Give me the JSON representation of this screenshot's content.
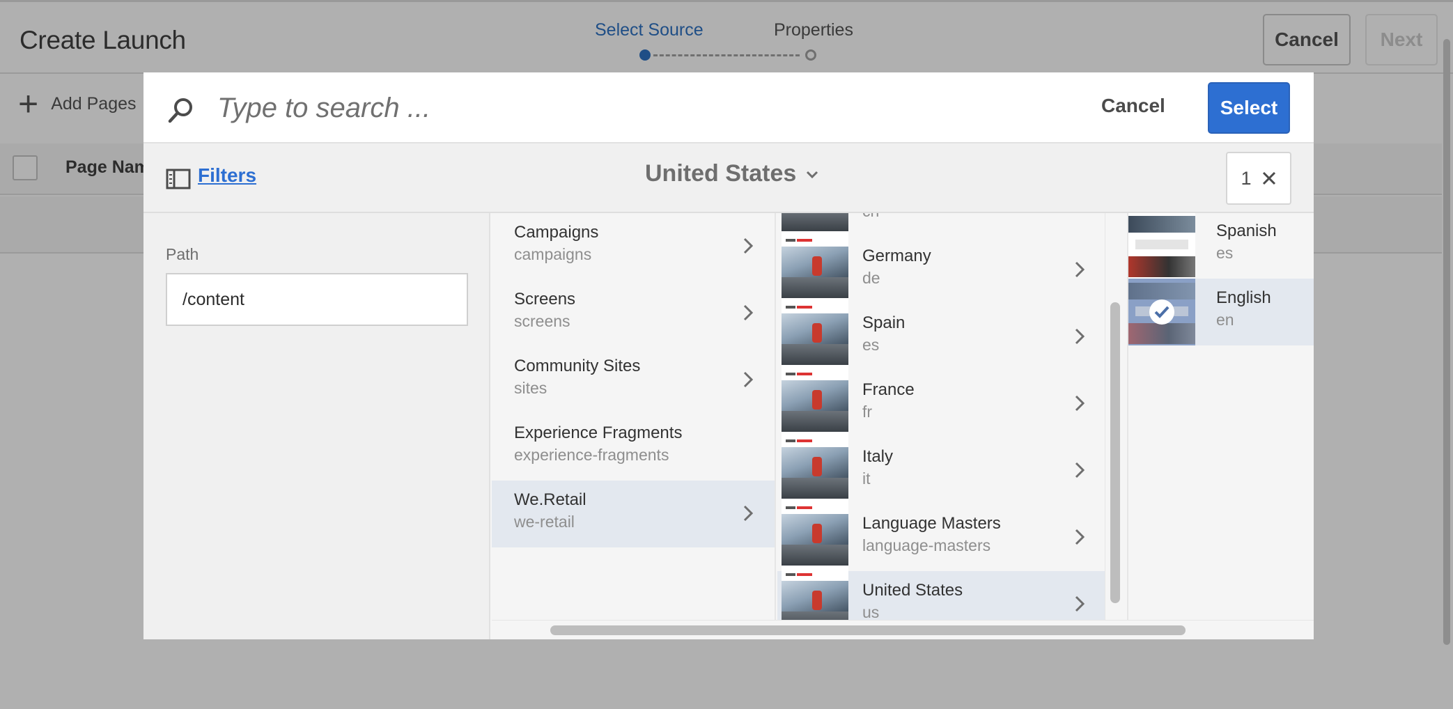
{
  "wizard": {
    "title": "Create Launch",
    "steps": [
      "Select Source",
      "Properties"
    ],
    "cancel_label": "Cancel",
    "next_label": "Next",
    "add_pages_label": "Add Pages",
    "table_column": "Page Nam"
  },
  "dialog": {
    "search_placeholder": "Type to search ...",
    "cancel_label": "Cancel",
    "select_label": "Select",
    "filters_label": "Filters",
    "current_location": "United States",
    "selection_count": "1",
    "path_label": "Path",
    "path_value": "/content"
  },
  "column1": [
    {
      "title": "Campaigns",
      "name": "campaigns",
      "has_children": true
    },
    {
      "title": "Screens",
      "name": "screens",
      "has_children": true
    },
    {
      "title": "Community Sites",
      "name": "sites",
      "has_children": true
    },
    {
      "title": "Experience Fragments",
      "name": "experience-fragments",
      "has_children": false
    },
    {
      "title": "We.Retail",
      "name": "we-retail",
      "has_children": true,
      "selected": true
    }
  ],
  "column2": [
    {
      "title": "",
      "name": "ch"
    },
    {
      "title": "Germany",
      "name": "de"
    },
    {
      "title": "Spain",
      "name": "es"
    },
    {
      "title": "France",
      "name": "fr"
    },
    {
      "title": "Italy",
      "name": "it"
    },
    {
      "title": "Language Masters",
      "name": "language-masters"
    },
    {
      "title": "United States",
      "name": "us",
      "selected": true
    }
  ],
  "column3": [
    {
      "title": "Spanish",
      "name": "es"
    },
    {
      "title": "English",
      "name": "en",
      "selected": true,
      "checked": true
    }
  ],
  "colors": {
    "accent": "#2d6fd2",
    "step_active": "#1f4e86",
    "overlay": "#b0b0b0",
    "selected_row": "#e3e8ef"
  },
  "icons": [
    "search-icon",
    "filter-panel-icon",
    "chevron-down-icon",
    "close-icon",
    "chevron-right-icon",
    "checkmark-icon",
    "plus-icon"
  ]
}
